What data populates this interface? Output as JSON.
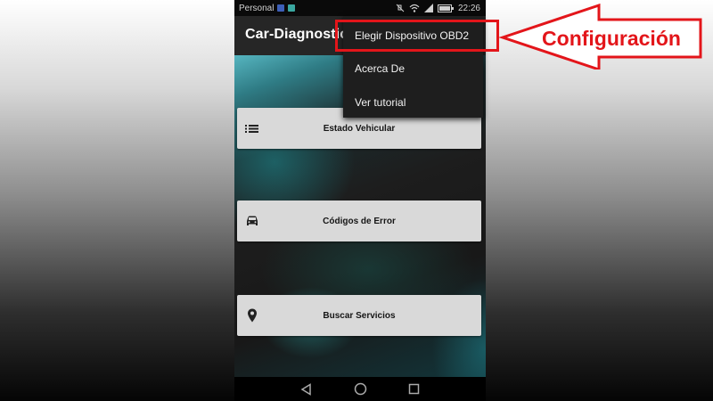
{
  "status_bar": {
    "carrier": "Personal",
    "time": "22:26",
    "icons": [
      "notification-icon",
      "gallery-icon",
      "mute-icon",
      "wifi-icon",
      "signal-icon",
      "battery-icon"
    ]
  },
  "app_bar": {
    "title": "Car-Diagnostic"
  },
  "overflow_menu": {
    "items": [
      {
        "label": "Elegir Dispositivo OBD2"
      },
      {
        "label": "Acerca De"
      },
      {
        "label": "Ver tutorial"
      }
    ]
  },
  "main_buttons": [
    {
      "label": "Estado Vehicular",
      "icon": "list-icon"
    },
    {
      "label": "Códigos de Error",
      "icon": "car-icon"
    },
    {
      "label": "Buscar Servicios",
      "icon": "location-pin-icon"
    }
  ],
  "nav_bar": {
    "icons": [
      "back-icon",
      "home-icon",
      "recents-icon"
    ]
  },
  "annotation": {
    "label": "Configuración",
    "color": "#e3151a"
  },
  "colors": {
    "app_bar": "#262626",
    "button_bg": "#d9d9d9",
    "menu_bg": "#1e1e1e",
    "accent_red": "#e3151a"
  }
}
